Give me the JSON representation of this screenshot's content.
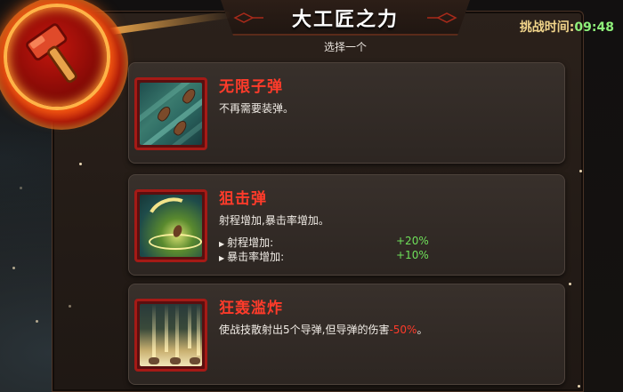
{
  "header": {
    "title": "大工匠之力",
    "subtitle": "选择一个",
    "timer_label": "挑战时间:",
    "timer_value": "09:48"
  },
  "skill_icon": "hammer-icon",
  "cards": [
    {
      "name": "无限子弹",
      "description": "不再需要装弹。",
      "icon": "flying-bullets-icon",
      "stats": []
    },
    {
      "name": "狙击弹",
      "description": "射程增加,暴击率增加。",
      "icon": "sniper-bullet-icon",
      "stats": [
        {
          "label": "射程增加:",
          "value": "+20%"
        },
        {
          "label": "暴击率增加:",
          "value": "+10%"
        }
      ]
    },
    {
      "name": "狂轰滥炸",
      "description_prefix": "使战技散射出5个导弹,但导弹的伤害",
      "description_highlight": "-50%",
      "description_suffix": "。",
      "icon": "missile-barrage-icon",
      "stats": []
    }
  ],
  "colors": {
    "card_title": "#ff3b2a",
    "stat_value": "#6fe05a",
    "timer_value": "#8ef07a",
    "timer_label": "#f0d48a"
  }
}
